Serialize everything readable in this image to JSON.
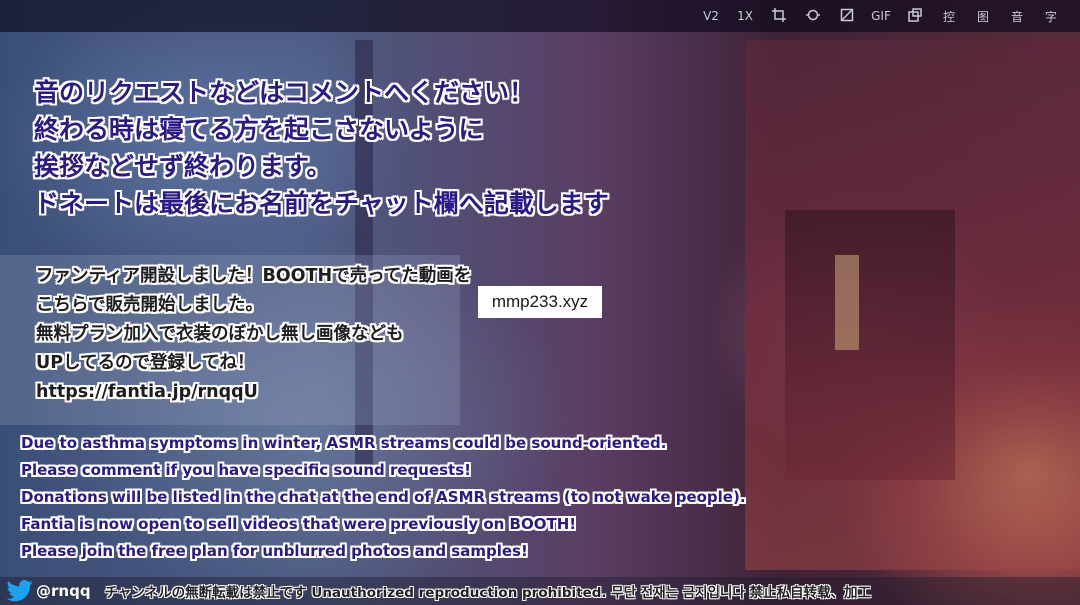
{
  "toolbar": {
    "items": [
      {
        "label": "V2",
        "icon": "version-icon"
      },
      {
        "label": "1X",
        "icon": "speed-icon"
      },
      {
        "label": "",
        "icon": "crop-icon"
      },
      {
        "label": "",
        "icon": "loop-icon"
      },
      {
        "label": "",
        "icon": "screenshot-icon"
      },
      {
        "label": "GIF",
        "icon": "gif-icon"
      },
      {
        "label": "",
        "icon": "picture-in-picture-icon"
      },
      {
        "label": "控",
        "icon": "control-icon"
      },
      {
        "label": "图",
        "icon": "image-icon"
      },
      {
        "label": "音",
        "icon": "audio-icon"
      },
      {
        "label": "字",
        "icon": "subtitle-icon"
      }
    ]
  },
  "overlay": {
    "jp_request": [
      "音のリクエストなどはコメントへください！",
      "終わる時は寝てる方を起こさないように",
      "挨拶などせず終わります。",
      "ドネートは最後にお名前をチャット欄へ記載します"
    ],
    "jp_fantia": [
      "ファンティア開設しました！BOOTHで売ってた動画を",
      "こちらで販売開始しました。",
      "無料プラン加入で衣装のぼかし無し画像なども",
      "UPしてるので登録してね！",
      "https://fantia.jp/rnqqU"
    ],
    "en_notice": [
      "Due to asthma symptoms in winter, ASMR streams could be sound-oriented.",
      "Please comment if you have specific sound requests!",
      "Donations will be listed in the chat at the end of ASMR streams (to not wake people).",
      "Fantia is now open to sell videos that were previously on BOOTH!",
      "Please join the free plan for unblurred photos and samples!"
    ]
  },
  "watermark": "mmp233.xyz",
  "footer": {
    "handle": "@rnqq",
    "ticker": "チャンネルの無断転載は禁止です Unauthorized reproduction prohibited. 무단 전재는 금지입니다 禁止私自转载、加工"
  },
  "colors": {
    "overlay_text": "#2a1a86",
    "twitter_blue": "#1da1f2"
  }
}
